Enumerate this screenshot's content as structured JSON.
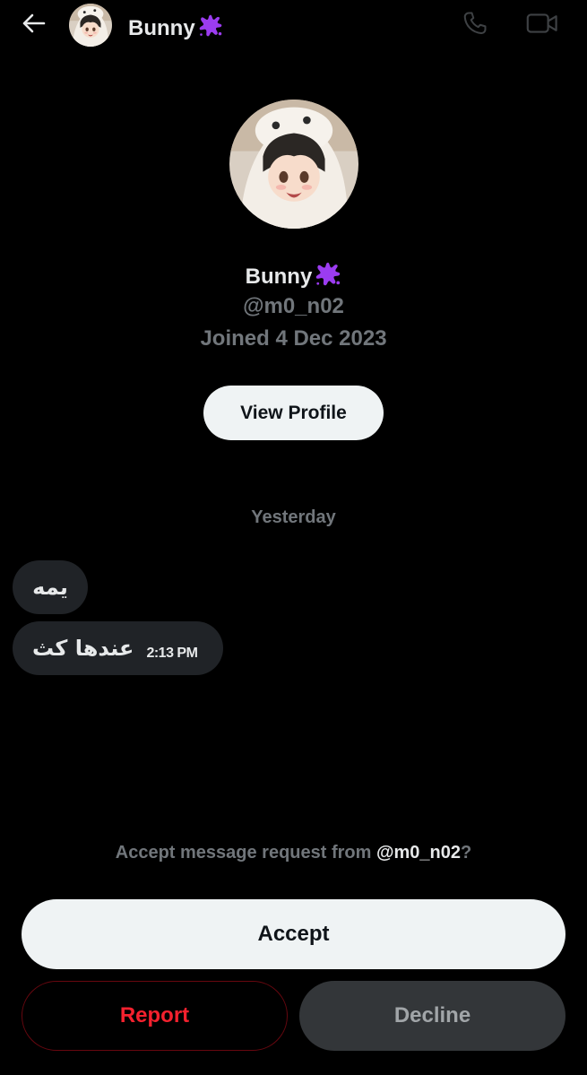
{
  "header": {
    "display_name": "Bunny",
    "back_icon": "arrow-left-icon",
    "call_icon": "phone-icon",
    "video_icon": "video-camera-icon",
    "name_emoji": "purple-splat-emoji"
  },
  "profile": {
    "display_name": "Bunny",
    "handle": "@m0_n02",
    "joined": "Joined 4 Dec 2023",
    "view_profile_label": "View Profile"
  },
  "conversation": {
    "date_divider": "Yesterday",
    "messages": [
      {
        "text": "يمه"
      },
      {
        "text": "عندها كث",
        "time": "2:13 PM"
      }
    ]
  },
  "request": {
    "prompt_prefix": "Accept message request from ",
    "prompt_handle": "@m0_n02",
    "prompt_suffix": "?",
    "accept_label": "Accept",
    "report_label": "Report",
    "decline_label": "Decline"
  },
  "colors": {
    "background": "#000000",
    "primary_text": "#e7e9ea",
    "secondary_text": "#71767b",
    "bubble": "#202327",
    "light_button": "#eff3f4",
    "report_red": "#f4212e",
    "decline_bg": "#333639",
    "splat_purple": "#9b3cf0"
  }
}
